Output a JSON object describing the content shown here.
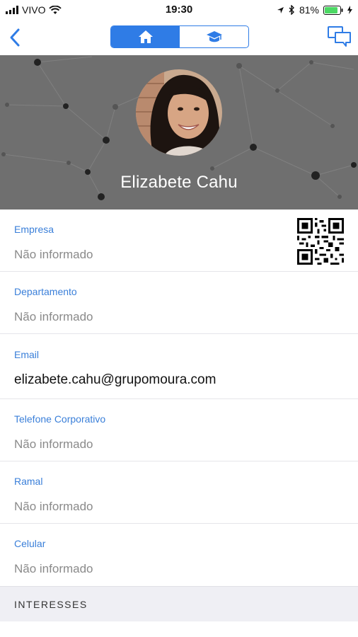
{
  "status_bar": {
    "carrier": "VIVO",
    "time": "19:30",
    "battery": "81%"
  },
  "nav": {
    "segments": [
      "home-icon",
      "graduation-cap-icon"
    ],
    "active_segment": 0,
    "accent": "#2f7ce6"
  },
  "profile": {
    "name": "Elizabete Cahu"
  },
  "fields": [
    {
      "label": "Empresa",
      "value": "Não informado"
    },
    {
      "label": "Departamento",
      "value": "Não informado"
    },
    {
      "label": "Email",
      "value": "elizabete.cahu@grupomoura.com"
    },
    {
      "label": "Telefone Corporativo",
      "value": "Não informado"
    },
    {
      "label": "Ramal",
      "value": "Não informado"
    },
    {
      "label": "Celular",
      "value": "Não informado"
    }
  ],
  "section": {
    "title": "INTERESSES"
  }
}
